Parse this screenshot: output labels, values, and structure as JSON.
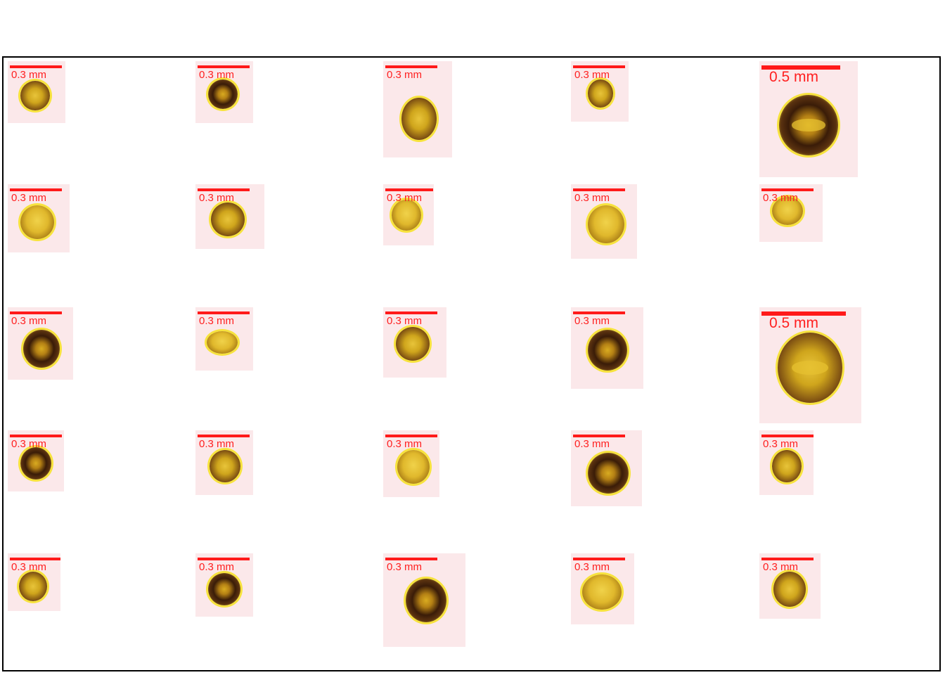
{
  "frame": {
    "border_color": "#000000",
    "tile_background": "#fbe8ea",
    "scalebar_color": "#ff1a1a"
  },
  "tiles": [
    {
      "label": "0.3 mm"
    },
    {
      "label": "0.3 mm"
    },
    {
      "label": "0.3 mm"
    },
    {
      "label": "0.3 mm"
    },
    {
      "label": "0.5 mm"
    },
    {
      "label": "0.3 mm"
    },
    {
      "label": "0.3 mm"
    },
    {
      "label": "0.3 mm"
    },
    {
      "label": "0.3 mm"
    },
    {
      "label": "0.3 mm"
    },
    {
      "label": "0.3 mm"
    },
    {
      "label": "0.3 mm"
    },
    {
      "label": "0.3 mm"
    },
    {
      "label": "0.3 mm"
    },
    {
      "label": "0.5 mm"
    },
    {
      "label": "0.3 mm"
    },
    {
      "label": "0.3 mm"
    },
    {
      "label": "0.3 mm"
    },
    {
      "label": "0.3 mm"
    },
    {
      "label": "0.3 mm"
    },
    {
      "label": "0.3 mm"
    },
    {
      "label": "0.3 mm"
    },
    {
      "label": "0.3 mm"
    },
    {
      "label": "0.3 mm"
    },
    {
      "label": "0.3 mm"
    }
  ]
}
